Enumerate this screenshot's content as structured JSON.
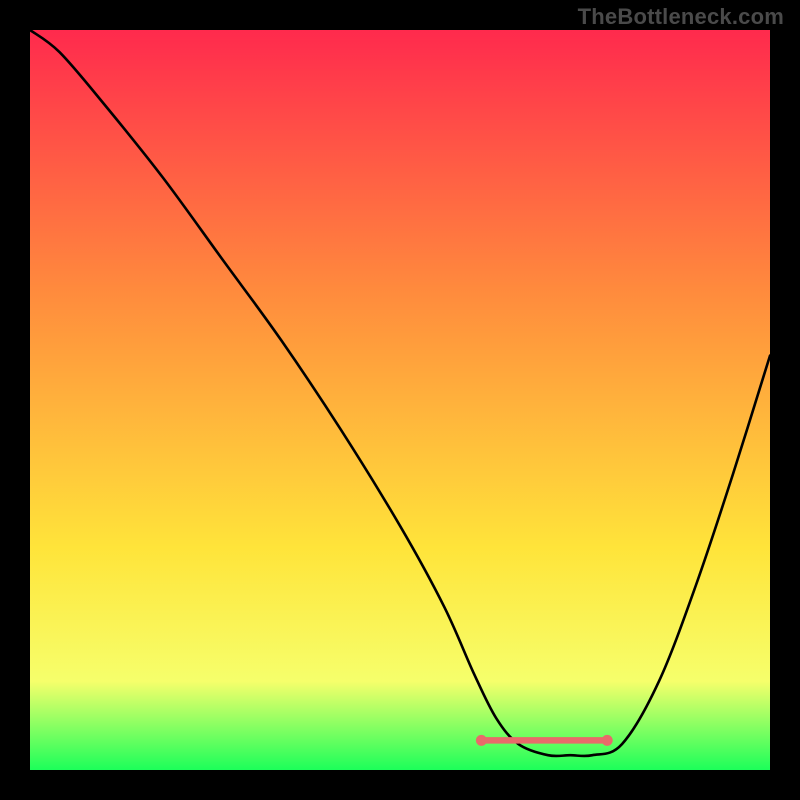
{
  "watermark": {
    "text": "TheBottleneck.com"
  },
  "chart_data": {
    "type": "line",
    "title": "",
    "xlabel": "",
    "ylabel": "",
    "xlim": [
      0,
      100
    ],
    "ylim": [
      0,
      100
    ],
    "series": [
      {
        "name": "bottleneck-curve",
        "x": [
          0,
          4,
          10,
          18,
          26,
          34,
          42,
          50,
          56,
          60,
          63,
          66,
          70,
          73,
          76,
          80,
          85,
          90,
          95,
          100
        ],
        "y": [
          100,
          97,
          90,
          80,
          69,
          58,
          46,
          33,
          22,
          13,
          7,
          3.5,
          2,
          2,
          2,
          3.5,
          12,
          25,
          40,
          56
        ]
      }
    ],
    "highlight_segment": {
      "name": "flat-range",
      "x": [
        61,
        78
      ],
      "y": [
        4,
        4
      ],
      "color": "#e86a6a"
    },
    "gradient": {
      "top": "#ff2a4d",
      "mid1": "#ff8a3d",
      "mid2": "#ffe43a",
      "low": "#f6ff6b",
      "bottom": "#1cff5a"
    }
  }
}
